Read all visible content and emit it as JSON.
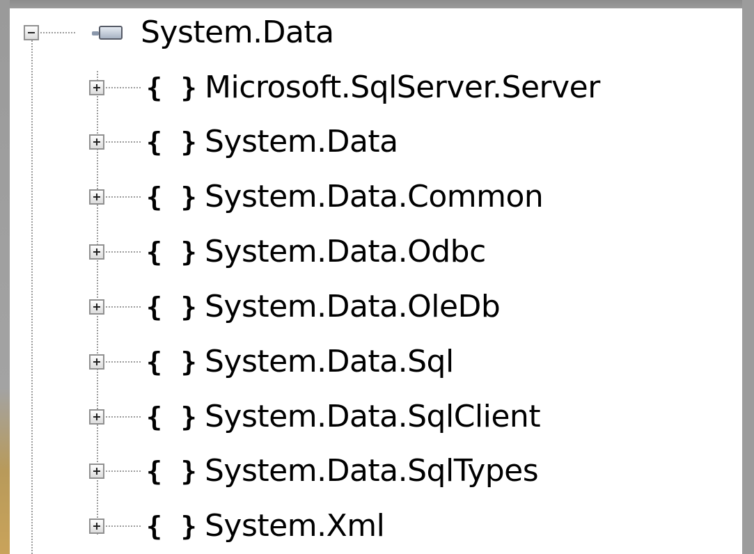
{
  "tree": {
    "root": {
      "label": "System.Data",
      "expander": "−",
      "icon": "assembly-icon",
      "expanded": true
    },
    "namespace_icon_text": "{ }",
    "children": [
      {
        "label": "Microsoft.SqlServer.Server",
        "expander": "+",
        "icon": "namespace-icon"
      },
      {
        "label": "System.Data",
        "expander": "+",
        "icon": "namespace-icon"
      },
      {
        "label": "System.Data.Common",
        "expander": "+",
        "icon": "namespace-icon"
      },
      {
        "label": "System.Data.Odbc",
        "expander": "+",
        "icon": "namespace-icon"
      },
      {
        "label": "System.Data.OleDb",
        "expander": "+",
        "icon": "namespace-icon"
      },
      {
        "label": "System.Data.Sql",
        "expander": "+",
        "icon": "namespace-icon"
      },
      {
        "label": "System.Data.SqlClient",
        "expander": "+",
        "icon": "namespace-icon"
      },
      {
        "label": "System.Data.SqlTypes",
        "expander": "+",
        "icon": "namespace-icon"
      },
      {
        "label": "System.Xml",
        "expander": "+",
        "icon": "namespace-icon"
      }
    ]
  },
  "colors": {
    "frame": "#8a8a8a",
    "panel": "#ffffff",
    "text": "#000000",
    "tree_lines": "#9a9a9a"
  }
}
